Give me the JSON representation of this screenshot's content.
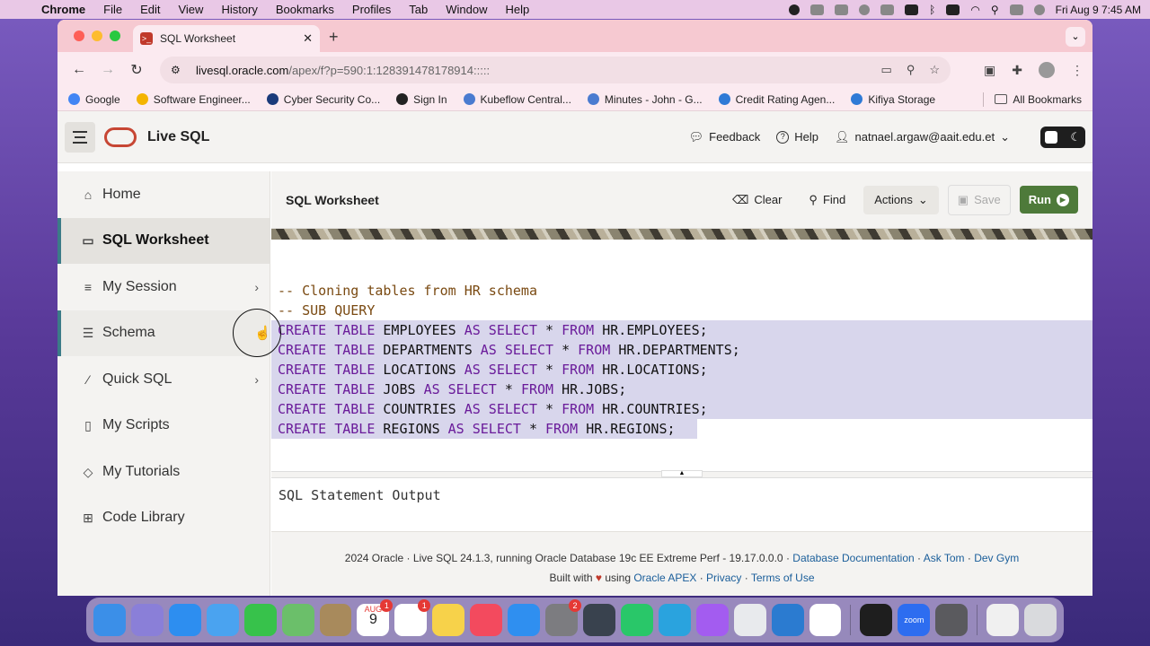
{
  "menubar": {
    "app_name": "Chrome",
    "items": [
      "File",
      "Edit",
      "View",
      "History",
      "Bookmarks",
      "Profiles",
      "Tab",
      "Window",
      "Help"
    ],
    "clock": "Fri Aug 9  7:45 AM"
  },
  "browser": {
    "tab_title": "SQL Worksheet",
    "url_host": "livesql.oracle.com",
    "url_rest": "/apex/f?p=590:1:128391478178914:::::",
    "bookmarks": [
      {
        "label": "Google",
        "color": "#4285f4"
      },
      {
        "label": "Software Engineer...",
        "color": "#f4b400"
      },
      {
        "label": "Cyber Security Co...",
        "color": "#1a3a7a"
      },
      {
        "label": "Sign In",
        "color": "#222222"
      },
      {
        "label": "Kubeflow Central...",
        "color": "#4a7bd0"
      },
      {
        "label": "Minutes - John - G...",
        "color": "#4a7bd0"
      },
      {
        "label": "Credit Rating Agen...",
        "color": "#2f7ad6"
      },
      {
        "label": "Kifiya Storage",
        "color": "#2f7ad6"
      }
    ],
    "all_bookmarks": "All Bookmarks"
  },
  "app": {
    "title": "Live SQL",
    "feedback": "Feedback",
    "help": "Help",
    "user": "natnael.argaw@aait.edu.et"
  },
  "sidebar": {
    "items": [
      {
        "label": "Home",
        "icon": "home-icon"
      },
      {
        "label": "SQL Worksheet",
        "icon": "terminal-icon"
      },
      {
        "label": "My Session",
        "icon": "list-icon"
      },
      {
        "label": "Schema",
        "icon": "database-icon"
      },
      {
        "label": "Quick SQL",
        "icon": "wand-icon"
      },
      {
        "label": "My Scripts",
        "icon": "file-icon"
      },
      {
        "label": "My Tutorials",
        "icon": "graduation-cap-icon"
      },
      {
        "label": "Code Library",
        "icon": "library-icon"
      }
    ]
  },
  "worksheet": {
    "title": "SQL Worksheet",
    "clear": "Clear",
    "find": "Find",
    "actions": "Actions",
    "save": "Save",
    "run": "Run",
    "output_label": "SQL Statement Output"
  },
  "editor": {
    "comment1": "-- Cloning tables from HR schema",
    "comment2": "-- SUB QUERY",
    "statements": [
      {
        "table": "EMPLOYEES",
        "source": "HR.EMPLOYEES;"
      },
      {
        "table": "DEPARTMENTS",
        "source": "HR.DEPARTMENTS;"
      },
      {
        "table": "LOCATIONS",
        "source": "HR.LOCATIONS;"
      },
      {
        "table": "JOBS",
        "source": "HR.JOBS;"
      },
      {
        "table": "COUNTRIES",
        "source": "HR.COUNTRIES;"
      },
      {
        "table": "REGIONS",
        "source": "HR.REGIONS;"
      }
    ],
    "kw_create_table": "CREATE TABLE",
    "kw_as_select": "AS SELECT",
    "kw_star": "*",
    "kw_from": "FROM"
  },
  "footer": {
    "line1_text": "2024 Oracle · Live SQL 24.1.3, running Oracle Database 19c EE Extreme Perf - 19.17.0.0.0 · ",
    "db_docs": "Database Documentation",
    "ask_tom": "Ask Tom",
    "dev_gym": "Dev Gym",
    "built_with": "Built with",
    "using": "using",
    "apex": "Oracle APEX",
    "privacy": "Privacy",
    "terms": "Terms of Use"
  },
  "dock": {
    "calendar_month": "AUG",
    "calendar_day": "9",
    "calendar_badge": "1",
    "reminders_badge": "1",
    "settings_badge": "2",
    "zoom_label": "zoom"
  },
  "colors": {
    "accent_teal": "#3b7b88",
    "run_green": "#4e7a3a",
    "oracle_red": "#c74634",
    "keyword_purple": "#6a1b9a",
    "comment_brown": "#7a4a12",
    "selection": "#d8d6ec"
  }
}
